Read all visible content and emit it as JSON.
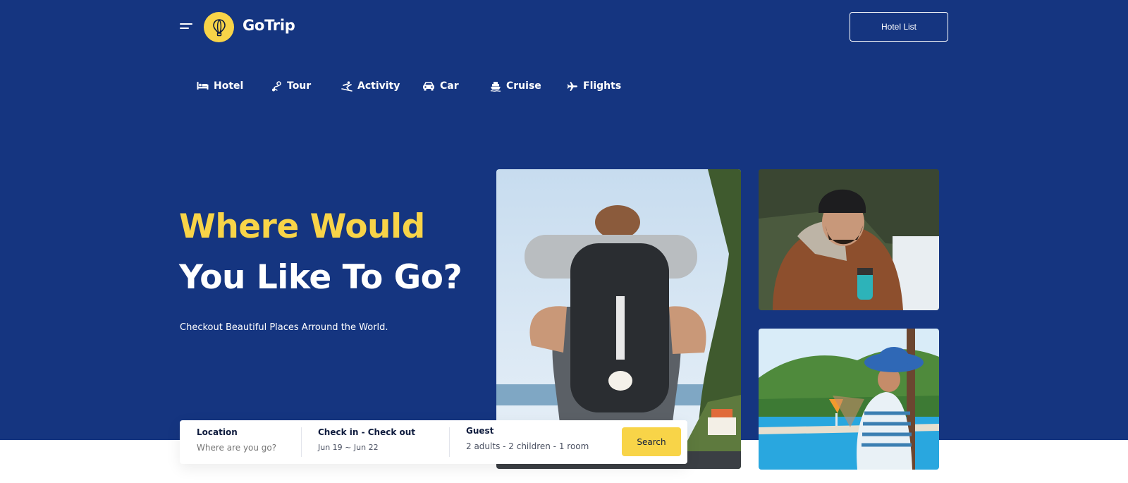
{
  "header": {
    "logo_text": "GoTrip",
    "logo_icon": "hot-air-balloon-icon",
    "menu_icon": "hamburger-menu-icon",
    "hotel_list_label": "Hotel List"
  },
  "tabs": [
    {
      "label": "Hotel",
      "icon": "bed-icon"
    },
    {
      "label": "Tour",
      "icon": "route-icon"
    },
    {
      "label": "Activity",
      "icon": "snowboard-icon"
    },
    {
      "label": "Car",
      "icon": "car-icon"
    },
    {
      "label": "Cruise",
      "icon": "ship-icon"
    },
    {
      "label": "Flights",
      "icon": "plane-icon"
    }
  ],
  "hero": {
    "title_line1": "Where Would",
    "title_line2": "You Like To Go?",
    "subtitle": "Checkout Beautiful Places Arround the World."
  },
  "search": {
    "location_label": "Location",
    "location_placeholder": "Where are you go?",
    "dates_label": "Check in - Check out",
    "dates_value": "Jun 19 ~ Jun 22",
    "guest_label": "Guest",
    "guest_value": "2 adults - 2 children - 1  room",
    "search_label": "Search"
  },
  "colors": {
    "hero_bg": "#153580",
    "accent_yellow": "#f8d448",
    "text_dark": "#0e1b3d"
  }
}
